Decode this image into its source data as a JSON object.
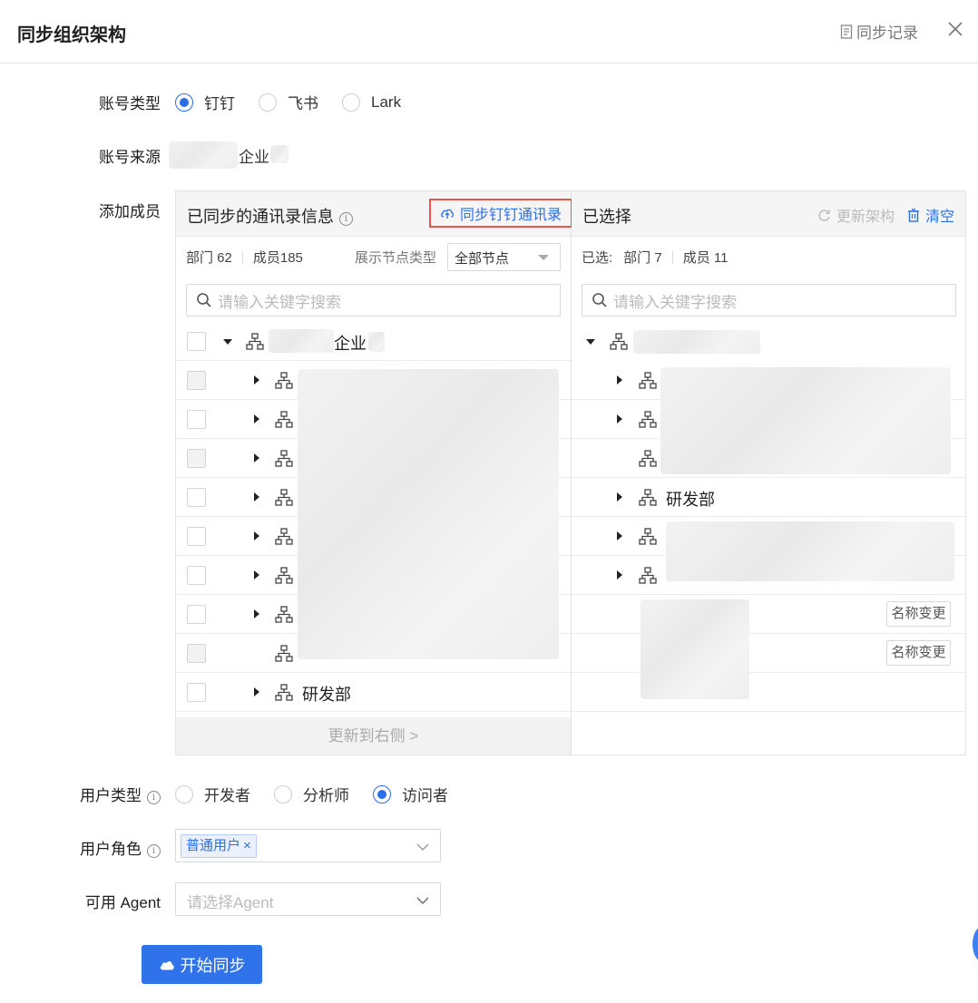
{
  "header": {
    "title": "同步组织架构",
    "record_label": "同步记录"
  },
  "account_type": {
    "label": "账号类型",
    "options": [
      {
        "label": "钉钉",
        "selected": true
      },
      {
        "label": "飞书",
        "selected": false
      },
      {
        "label": "Lark",
        "selected": false
      }
    ]
  },
  "account_source": {
    "label": "账号来源",
    "value_suffix": "企业"
  },
  "add_members": {
    "label": "添加成员",
    "left": {
      "title": "已同步的通讯录信息",
      "sync_button": "同步钉钉通讯录",
      "dept_stat": "部门 62",
      "member_stat": "成员185",
      "node_type_label": "展示节点类型",
      "node_type_value": "全部节点",
      "search_placeholder": "请输入关键字搜索",
      "root_suffix": "企业",
      "last_row_label": "研发部",
      "update_button": "更新到右侧 >"
    },
    "right": {
      "title": "已选择",
      "update_label": "更新架构",
      "clear_label": "清空",
      "selected_prefix": "已选:",
      "dept_stat": "部门 7",
      "member_stat": "成员 11",
      "search_placeholder": "请输入关键字搜索",
      "dept_label": "研发部",
      "rename_tag": "名称变更"
    }
  },
  "user_type": {
    "label": "用户类型",
    "options": [
      {
        "label": "开发者",
        "selected": false
      },
      {
        "label": "分析师",
        "selected": false
      },
      {
        "label": "访问者",
        "selected": true
      }
    ]
  },
  "user_role": {
    "label": "用户角色",
    "tag": "普通用户"
  },
  "agent": {
    "label": "可用 Agent",
    "placeholder": "请选择Agent"
  },
  "start_button": "开始同步",
  "colors": {
    "primary": "#2b6fe8",
    "highlight_border": "#e8574a"
  }
}
